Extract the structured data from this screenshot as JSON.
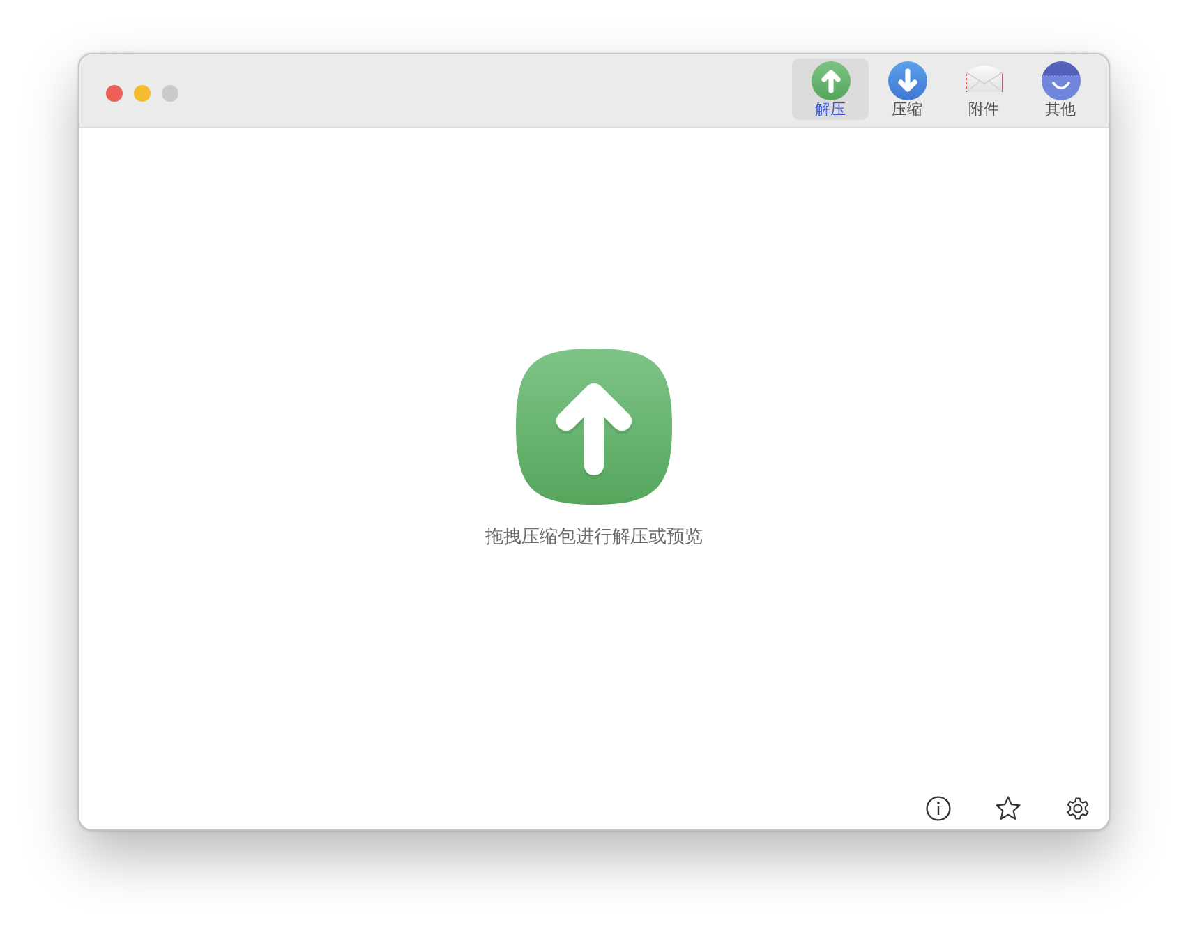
{
  "window": {
    "controls": [
      {
        "color": "#ec5f57"
      },
      {
        "color": "#f4bb2e"
      },
      {
        "color": "#cacaca"
      }
    ]
  },
  "toolbar": {
    "tabs": [
      {
        "label": "解压",
        "kind": "extract",
        "selected": true
      },
      {
        "label": "压缩",
        "kind": "compress",
        "selected": false
      },
      {
        "label": "附件",
        "kind": "attachment",
        "selected": false
      },
      {
        "label": "其他",
        "kind": "other",
        "selected": false
      }
    ]
  },
  "drop_zone": {
    "hint": "拖拽压缩包进行解压或预览"
  }
}
